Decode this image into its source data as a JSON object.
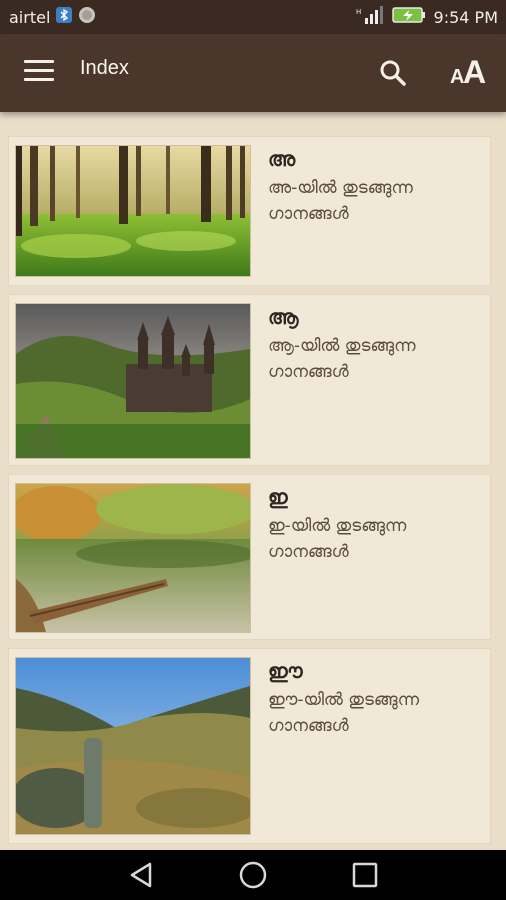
{
  "status_bar": {
    "carrier": "airtel",
    "time": "9:54 PM",
    "icons": [
      "bluetooth-icon",
      "notification-icon",
      "signal-icon",
      "battery-charging-icon"
    ]
  },
  "app_bar": {
    "title": "Index",
    "icons": [
      "menu-icon",
      "search-icon",
      "font-size-icon"
    ]
  },
  "items": [
    {
      "letter": "അ",
      "description": "അ-യിൽ തുടങ്ങുന്ന ഗാനങ്ങൾ",
      "image": "forest-image"
    },
    {
      "letter": "ആ",
      "description": "ആ-യിൽ തുടങ്ങുന്ന ഗാനങ്ങൾ",
      "image": "castle-image"
    },
    {
      "letter": "ഇ",
      "description": "ഇ-യിൽ തുടങ്ങുന്ന ഗാനങ്ങൾ",
      "image": "lake-boat-image"
    },
    {
      "letter": "ഈ",
      "description": "ഈ-യിൽ തുടങ്ങുന്ന ഗാനങ്ങൾ",
      "image": "valley-image"
    }
  ],
  "nav_bar": {
    "icons": [
      "back-icon",
      "home-icon",
      "recents-icon"
    ]
  },
  "colors": {
    "status_bar": "#3a2a22",
    "app_bar": "#4a362b",
    "background": "#e9dfc9",
    "card": "#f1e9d8"
  }
}
